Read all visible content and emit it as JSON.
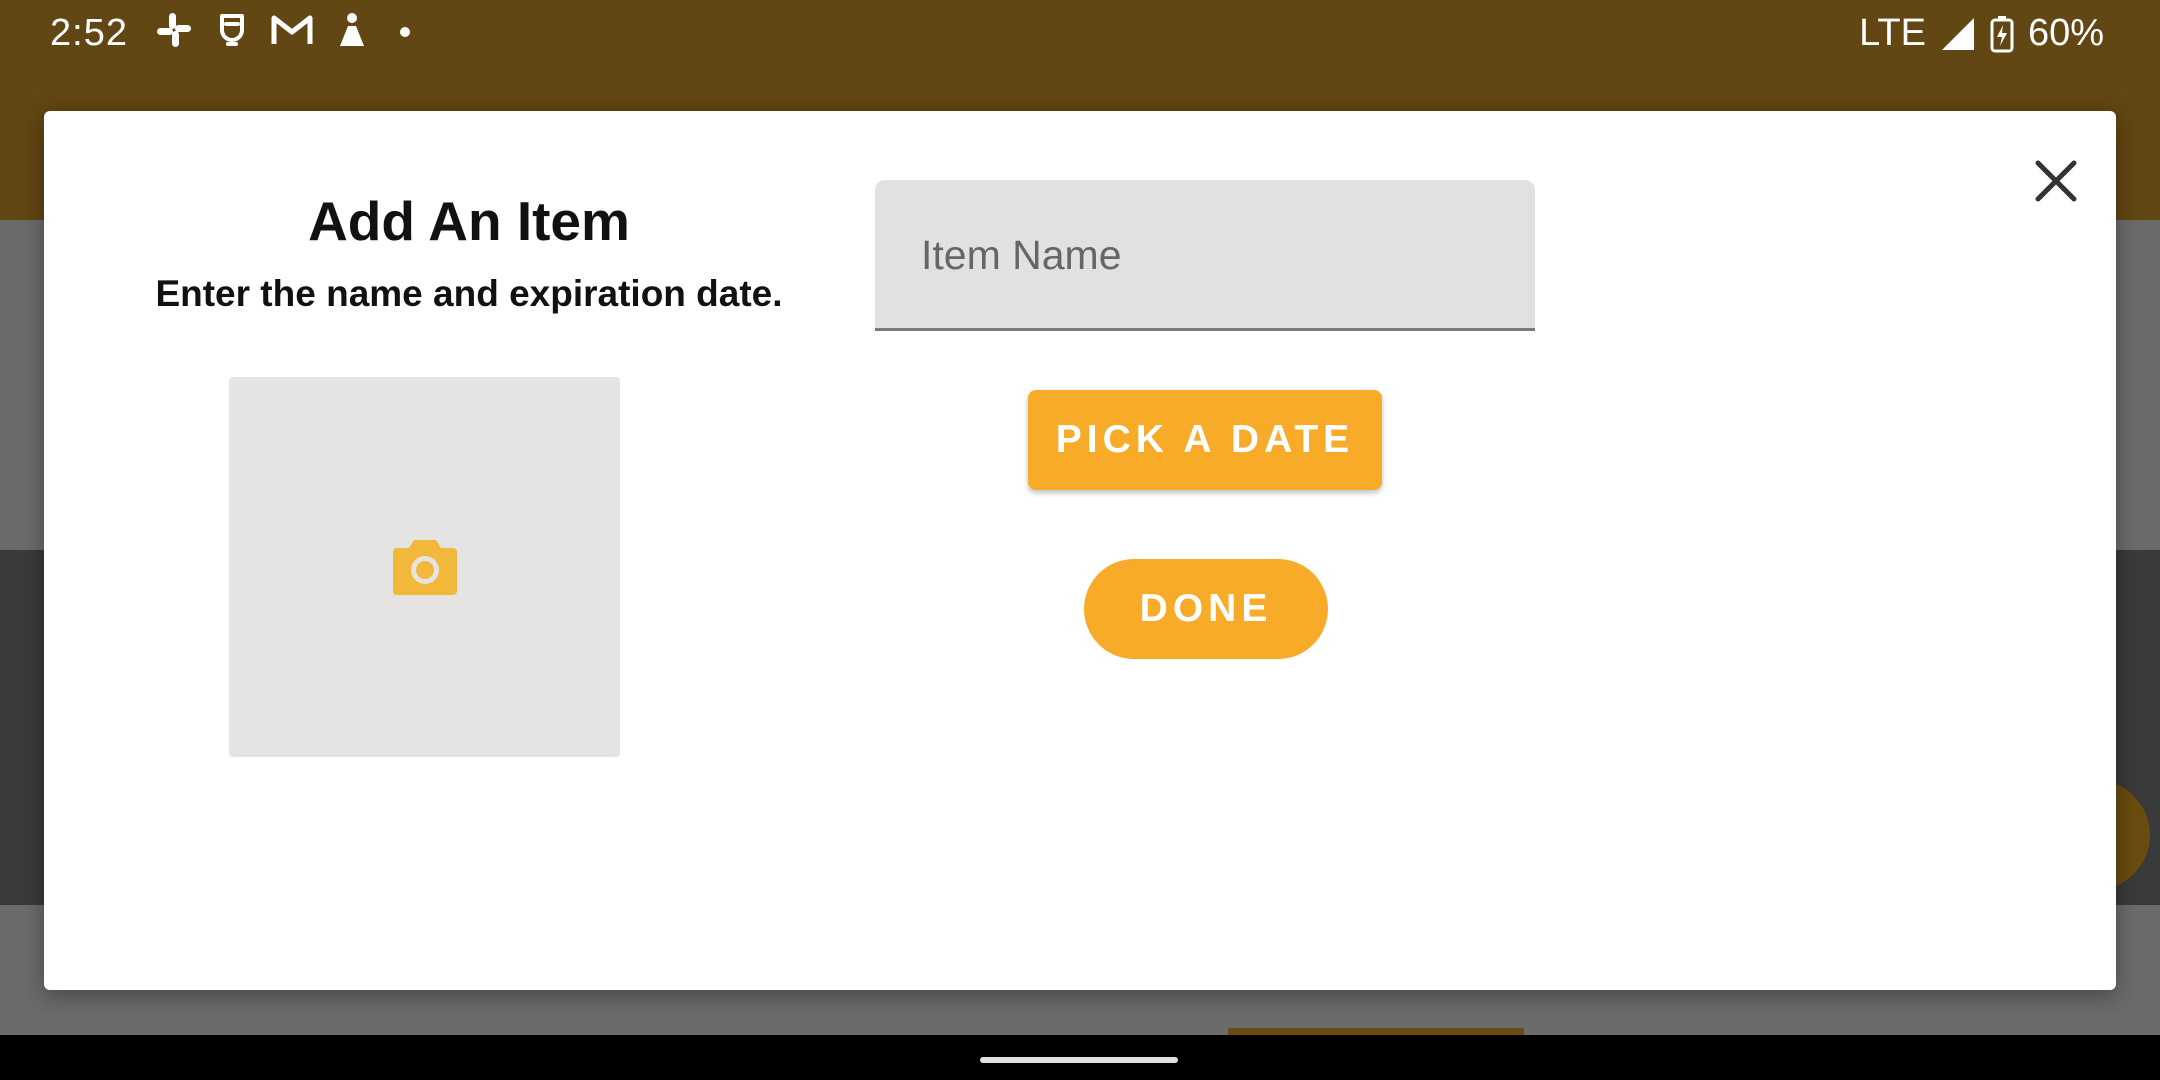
{
  "status_bar": {
    "time": "2:52",
    "notification_icons": [
      "slack-icon",
      "gesture-icon",
      "gmail-icon",
      "game-icon",
      "more-dot-icon"
    ],
    "network": "LTE",
    "battery_percent": "60%"
  },
  "dialog": {
    "title": "Add An Item",
    "subtitle": "Enter the name and expiration date.",
    "photo_icon": "camera-icon",
    "item_name_placeholder": "Item Name",
    "item_name_value": "",
    "pick_date_label": "PICK A DATE",
    "done_label": "DONE",
    "close_icon": "close-icon"
  },
  "colors": {
    "accent": "#f7ab28",
    "header": "#624613",
    "camera_icon": "#f2b83b"
  }
}
